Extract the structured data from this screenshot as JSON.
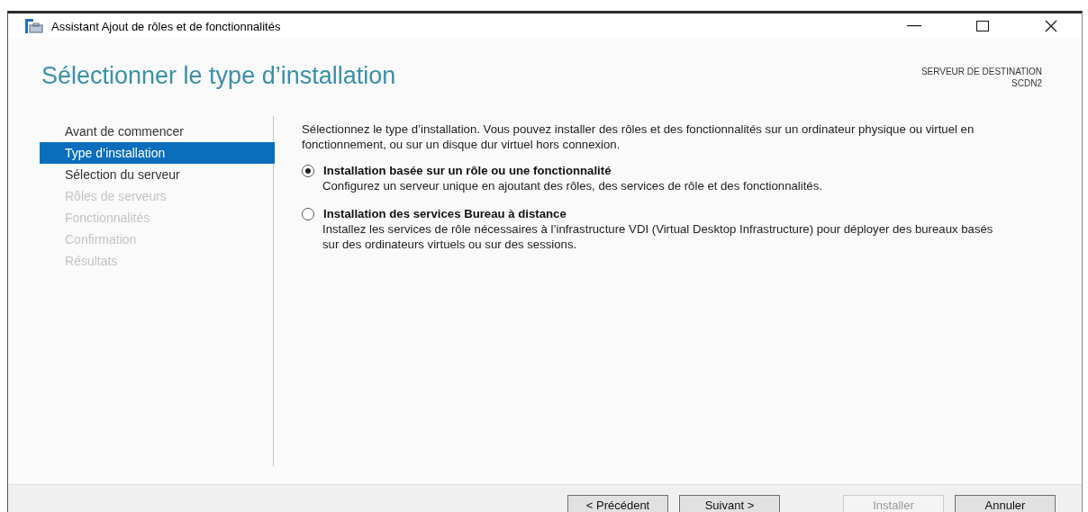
{
  "window": {
    "title": "Assistant Ajout de rôles et de fonctionnalités"
  },
  "heading": "Sélectionner le type d’installation",
  "destination": {
    "label": "SERVEUR DE DESTINATION",
    "server": "SCDN2"
  },
  "nav": [
    {
      "label": "Avant de commencer",
      "selected": false,
      "disabled": false
    },
    {
      "label": "Type d’installation",
      "selected": true,
      "disabled": false
    },
    {
      "label": "Sélection du serveur",
      "selected": false,
      "disabled": false
    },
    {
      "label": "Rôles de serveurs",
      "selected": false,
      "disabled": true
    },
    {
      "label": "Fonctionnalités",
      "selected": false,
      "disabled": true
    },
    {
      "label": "Confirmation",
      "selected": false,
      "disabled": true
    },
    {
      "label": "Résultats",
      "selected": false,
      "disabled": true
    }
  ],
  "intro": "Sélectionnez le type d’installation. Vous pouvez installer des rôles et des fonctionnalités sur un ordinateur physique ou virtuel en fonctionnement, ou sur un disque dur virtuel hors connexion.",
  "options": [
    {
      "label": "Installation basée sur un rôle ou une fonctionnalité",
      "description": "Configurez un serveur unique en ajoutant des rôles, des services de rôle et des fonctionnalités.",
      "selected": true
    },
    {
      "label": "Installation des services Bureau à distance",
      "description": "Installez les services de rôle nécessaires à l’infrastructure VDI (Virtual Desktop Infrastructure) pour déployer des bureaux basés sur des ordinateurs virtuels ou sur des sessions.",
      "selected": false
    }
  ],
  "buttons": [
    {
      "label": "< Précédent",
      "disabled": false
    },
    {
      "label": "Suivant >",
      "disabled": false
    },
    {
      "label": "Installer",
      "disabled": true
    },
    {
      "label": "Annuler",
      "disabled": false
    }
  ]
}
